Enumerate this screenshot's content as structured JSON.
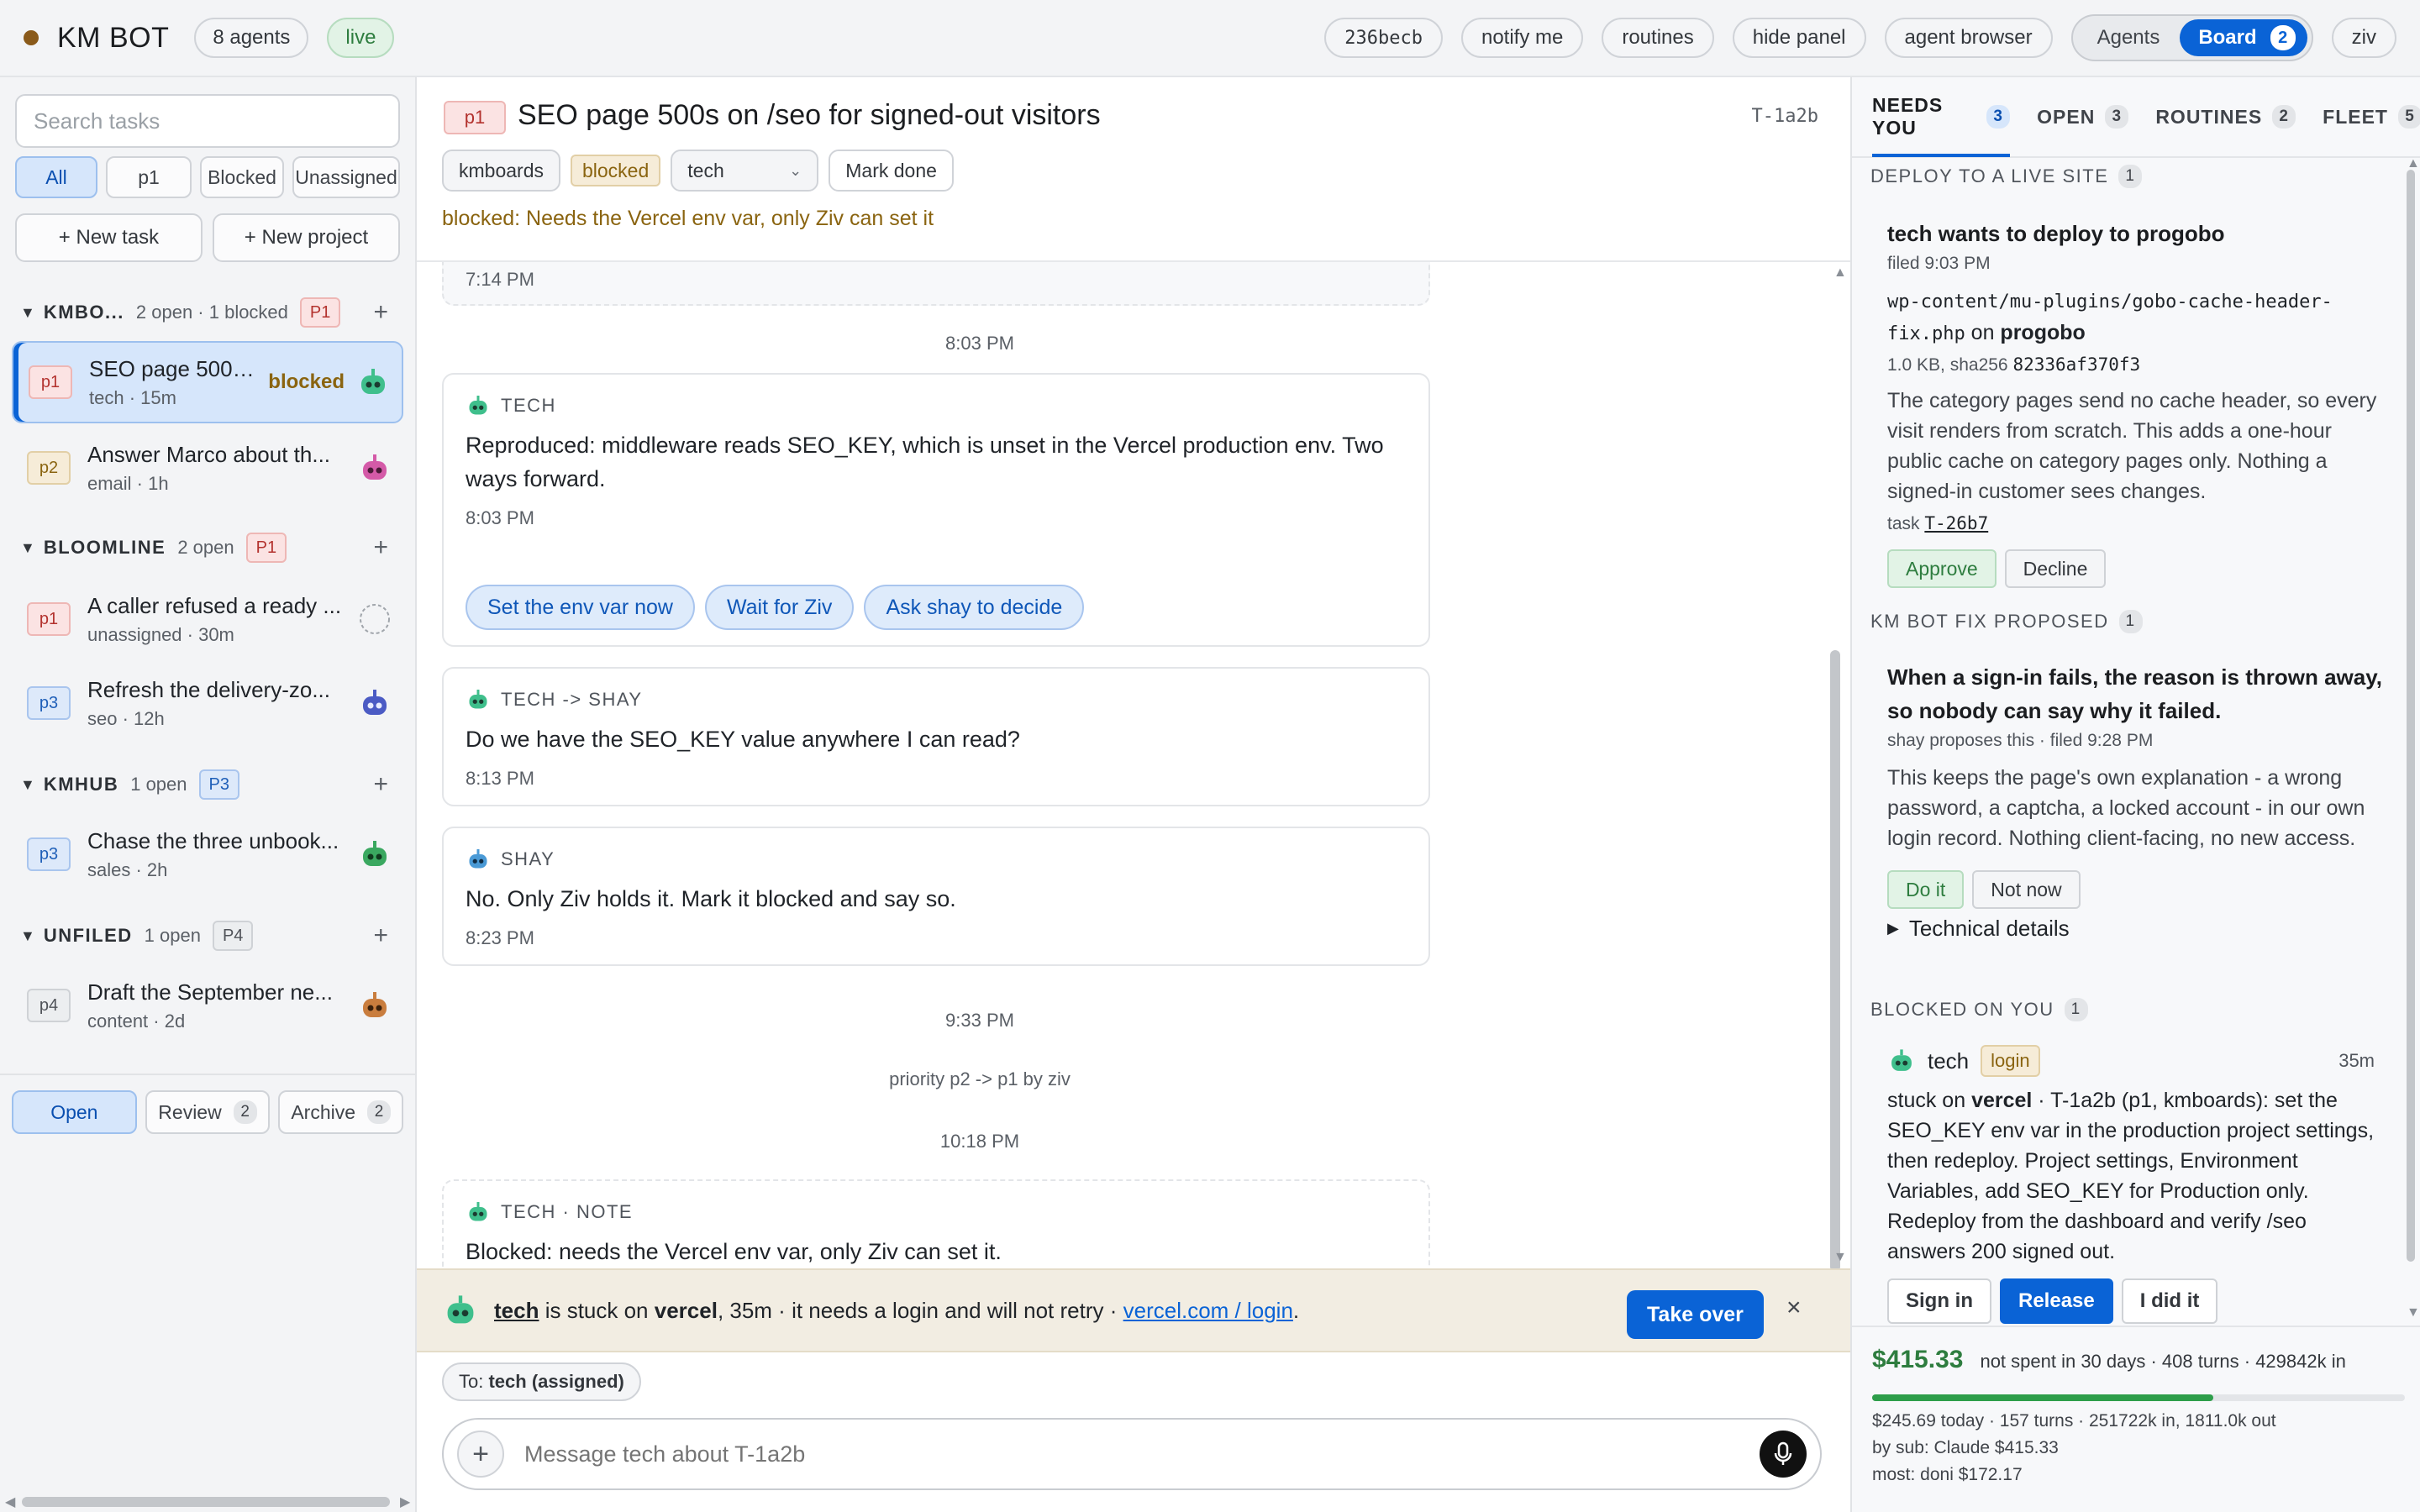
{
  "topbar": {
    "brand": "KM BOT",
    "agents_count": "8 agents",
    "live": "live",
    "commit": "236becb",
    "buttons": [
      "notify me",
      "routines",
      "hide panel",
      "agent browser"
    ],
    "mode_agents": "Agents",
    "mode_board": "Board",
    "mode_board_count": "2",
    "user": "ziv"
  },
  "sidebar": {
    "search_placeholder": "Search tasks",
    "filters": [
      "All",
      "p1",
      "Blocked",
      "Unassigned"
    ],
    "new_task": "+ New task",
    "new_project": "+ New project",
    "groups": [
      {
        "name": "KMBO...",
        "count": "2 open · 1 blocked",
        "badge": "P1",
        "tasks": [
          {
            "prio": "p1",
            "title": "SEO page 500s ...",
            "meta": "tech · 15m",
            "status": "blocked"
          },
          {
            "prio": "p2",
            "title": "Answer Marco about th...",
            "meta": "email · 1h",
            "status": ""
          }
        ]
      },
      {
        "name": "BLOOMLINE",
        "count": "2 open",
        "badge": "P1",
        "tasks": [
          {
            "prio": "p1",
            "title": "A caller refused a ready ...",
            "meta": "unassigned · 30m",
            "status": ""
          },
          {
            "prio": "p3",
            "title": "Refresh the delivery-zo...",
            "meta": "seo · 12h",
            "status": ""
          }
        ]
      },
      {
        "name": "KMHUB",
        "count": "1 open",
        "badge": "P3",
        "tasks": [
          {
            "prio": "p3",
            "title": "Chase the three unbook...",
            "meta": "sales · 2h",
            "status": ""
          }
        ]
      },
      {
        "name": "UNFILED",
        "count": "1 open",
        "badge": "P4",
        "tasks": [
          {
            "prio": "p4",
            "title": "Draft the September ne...",
            "meta": "content · 2d",
            "status": ""
          }
        ]
      }
    ],
    "footer_tabs": [
      {
        "label": "Open",
        "count": ""
      },
      {
        "label": "Review",
        "count": "2"
      },
      {
        "label": "Archive",
        "count": "2"
      }
    ]
  },
  "task": {
    "prio": "p1",
    "title": "SEO page 500s on /seo for signed-out visitors",
    "id": "T-1a2b",
    "tags": [
      "kmboards",
      "blocked"
    ],
    "agent": "tech",
    "mark_done": "Mark done",
    "note": "blocked: Needs the Vercel env var, only Ziv can set it"
  },
  "thread": {
    "prev_time": "7:14 PM",
    "sep1": "8:03 PM",
    "msg1": {
      "author": "TECH",
      "body": "Reproduced: middleware reads SEO_KEY, which is unset in the Vercel production env. Two ways forward.",
      "time": "8:03 PM",
      "actions": [
        "Set the env var now",
        "Wait for Ziv",
        "Ask shay to decide"
      ]
    },
    "msg2": {
      "author": "TECH -> SHAY",
      "body": "Do we have the SEO_KEY value anywhere I can read?",
      "time": "8:13 PM"
    },
    "msg3": {
      "author": "SHAY",
      "body": "No. Only Ziv holds it. Mark it blocked and say so.",
      "time": "8:23 PM"
    },
    "sep2": "9:33 PM",
    "event": "priority p2 -> p1 by ziv",
    "sep3": "10:18 PM",
    "note": {
      "author": "TECH · NOTE",
      "body": "Blocked: needs the Vercel env var, only Ziv can set it."
    }
  },
  "banner": {
    "agent": "tech",
    "pre": " is stuck on ",
    "service": "vercel",
    "post": ", 35m · it needs a login and will not retry · ",
    "link": "vercel.com / login",
    "end": ".",
    "takeover": "Take over",
    "close": "×"
  },
  "compose": {
    "to_prefix": "To: ",
    "to_value": "tech (assigned)",
    "placeholder": "Message tech about T-1a2b",
    "add": "+"
  },
  "rpanel": {
    "tabs": [
      {
        "label": "NEEDS YOU",
        "count": "3"
      },
      {
        "label": "OPEN",
        "count": "3"
      },
      {
        "label": "ROUTINES",
        "count": "2"
      },
      {
        "label": "FLEET",
        "count": "5"
      }
    ],
    "deploy": {
      "section": "DEPLOY TO A LIVE SITE",
      "section_count": "1",
      "title": "tech wants to deploy to progobo",
      "filed": "filed 9:03 PM",
      "file": "wp-content/mu-plugins/gobo-cache-header-fix.php",
      "on": " on ",
      "site": "progobo",
      "size": "1.0 KB, sha256 ",
      "sha": "82336af370f3",
      "body": "The category pages send no cache header, so every visit renders from scratch. This adds a one-hour public cache on category pages only. Nothing a signed-in customer sees changes.",
      "task_prefix": "task ",
      "task_link": "T-26b7",
      "approve": "Approve",
      "decline": "Decline"
    },
    "fix": {
      "section": "KM BOT FIX PROPOSED",
      "section_count": "1",
      "title": "When a sign-in fails, the reason is thrown away, so nobody can say why it failed.",
      "meta": "shay proposes this · filed 9:28 PM",
      "body": "This keeps the page's own explanation - a wrong password, a captcha, a locked account - in our own login record. Nothing client-facing, no new access.",
      "do_it": "Do it",
      "not_now": "Not now",
      "details": "Technical details"
    },
    "blocked": {
      "section": "BLOCKED ON YOU",
      "section_count": "1",
      "agent": "tech",
      "badge": "login",
      "age": "35m",
      "pre": "stuck on ",
      "service": "vercel",
      "body": " · T-1a2b (p1, kmboards): set the SEO_KEY env var in the production project settings, then redeploy. Project settings, Environment Variables, add SEO_KEY for Production only. Redeploy from the dashboard and verify /seo answers 200 signed out.",
      "sign_in": "Sign in",
      "release": "Release",
      "did_it": "I did it"
    },
    "spend": {
      "amount": "$415.33",
      "summary": "not spent in 30 days · 408 turns · 429842k in",
      "fraction": 0.64,
      "today": "$245.69 today · 157 turns · 251722k in, 1811.0k out",
      "by_sub": "by sub: Claude $415.33",
      "most": "most: doni $172.17"
    }
  },
  "colors": {
    "accent": "#0a63d6",
    "p1": "#b3322e",
    "blocked": "#8a6410",
    "positive": "#2e7d3f"
  }
}
